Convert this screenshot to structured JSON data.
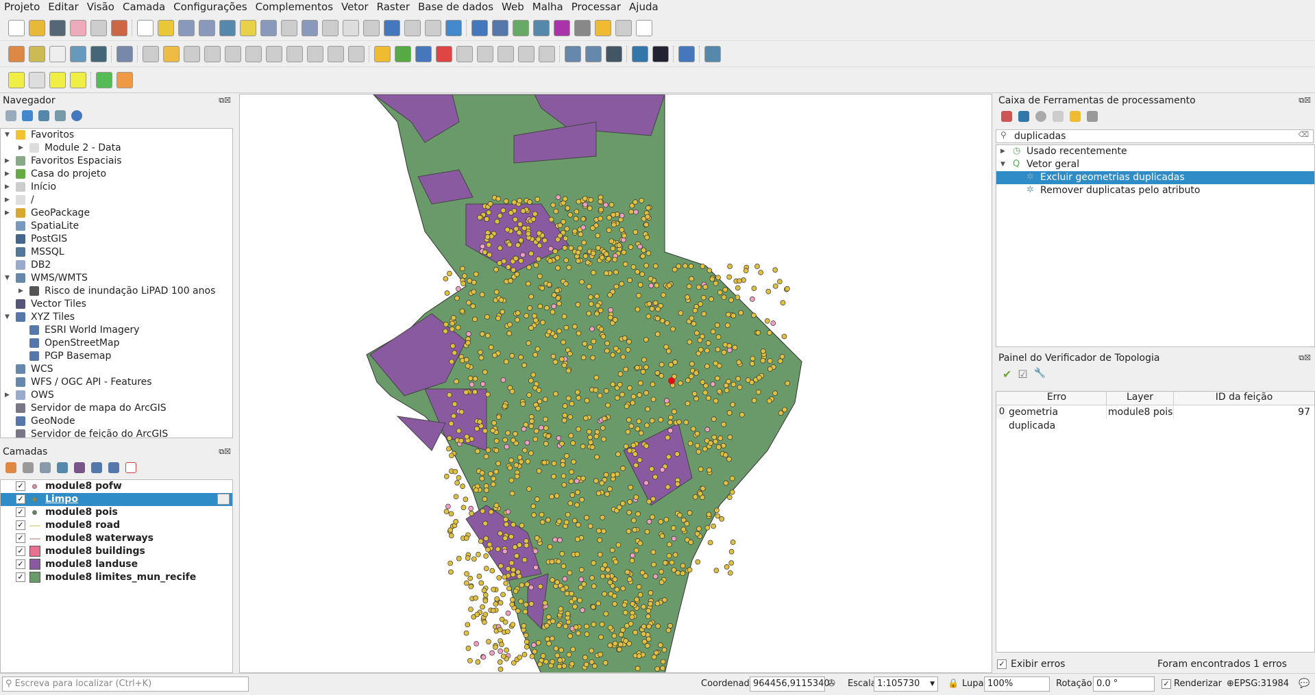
{
  "menu": [
    "Projeto",
    "Editar",
    "Visão",
    "Camada",
    "Configurações",
    "Complementos",
    "Vetor",
    "Raster",
    "Base de dados",
    "Web",
    "Malha",
    "Processar",
    "Ajuda"
  ],
  "navigator": {
    "title": "Navegador",
    "items": [
      {
        "label": "Favoritos",
        "level": 0,
        "expanded": true,
        "icon": "star-icon",
        "color": "#f2c230"
      },
      {
        "label": "Module 2 - Data",
        "level": 1,
        "expanded": false,
        "icon": "folder-icon",
        "color": "#ddd"
      },
      {
        "label": "Favoritos Espaciais",
        "level": 0,
        "expanded": false,
        "icon": "spatial-bookmark-icon",
        "color": "#8a8"
      },
      {
        "label": "Casa do projeto",
        "level": 0,
        "expanded": false,
        "icon": "project-home-icon",
        "color": "#6a4"
      },
      {
        "label": "Início",
        "level": 0,
        "expanded": false,
        "icon": "home-icon",
        "color": "#ccc"
      },
      {
        "label": "/",
        "level": 0,
        "expanded": false,
        "icon": "folder-icon",
        "color": "#ddd"
      },
      {
        "label": "GeoPackage",
        "level": 0,
        "expanded": false,
        "icon": "geopackage-icon",
        "color": "#d9a830"
      },
      {
        "label": "SpatiaLite",
        "level": 0,
        "expanded": null,
        "icon": "spatialite-icon",
        "color": "#7799bb"
      },
      {
        "label": "PostGIS",
        "level": 0,
        "expanded": null,
        "icon": "postgis-icon",
        "color": "#446688"
      },
      {
        "label": "MSSQL",
        "level": 0,
        "expanded": null,
        "icon": "mssql-icon",
        "color": "#557799"
      },
      {
        "label": "DB2",
        "level": 0,
        "expanded": null,
        "icon": "db2-icon",
        "color": "#99aacc"
      },
      {
        "label": "WMS/WMTS",
        "level": 0,
        "expanded": true,
        "icon": "globe-icon",
        "color": "#6688aa"
      },
      {
        "label": "Risco de inundação LiPAD 100 anos",
        "level": 1,
        "expanded": false,
        "icon": "wms-layer-icon",
        "color": "#555"
      },
      {
        "label": "Vector Tiles",
        "level": 0,
        "expanded": null,
        "icon": "vector-tiles-icon",
        "color": "#557"
      },
      {
        "label": "XYZ Tiles",
        "level": 0,
        "expanded": true,
        "icon": "grid-icon",
        "color": "#5577aa"
      },
      {
        "label": "ESRI World Imagery",
        "level": 1,
        "expanded": null,
        "icon": "grid-icon",
        "color": "#5577aa"
      },
      {
        "label": "OpenStreetMap",
        "level": 1,
        "expanded": null,
        "icon": "grid-icon",
        "color": "#5577aa"
      },
      {
        "label": "PGP Basemap",
        "level": 1,
        "expanded": null,
        "icon": "grid-icon",
        "color": "#5577aa"
      },
      {
        "label": "WCS",
        "level": 0,
        "expanded": null,
        "icon": "globe-icon",
        "color": "#6688aa"
      },
      {
        "label": "WFS / OGC API - Features",
        "level": 0,
        "expanded": null,
        "icon": "globe-icon",
        "color": "#6688aa"
      },
      {
        "label": "OWS",
        "level": 0,
        "expanded": false,
        "icon": "globe-icon",
        "color": "#99aacc"
      },
      {
        "label": "Servidor de mapa do ArcGIS",
        "level": 0,
        "expanded": null,
        "icon": "arcgis-icon",
        "color": "#778"
      },
      {
        "label": "GeoNode",
        "level": 0,
        "expanded": null,
        "icon": "geonode-icon",
        "color": "#5577aa"
      },
      {
        "label": "Servidor de feição do ArcGIS",
        "level": 0,
        "expanded": null,
        "icon": "arcgis-icon",
        "color": "#778"
      }
    ]
  },
  "layers": {
    "title": "Camadas",
    "items": [
      {
        "label": "module8 pofw",
        "symbol": "point",
        "color": "#e88aa0",
        "checked": true,
        "selected": false
      },
      {
        "label": "Limpo",
        "symbol": "point",
        "color": "#8a8a40",
        "checked": true,
        "selected": true
      },
      {
        "label": "module8 pois",
        "symbol": "point",
        "color": "#5a8a5a",
        "checked": true,
        "selected": false
      },
      {
        "label": "module8 road",
        "symbol": "line",
        "color": "#e8dca0",
        "checked": true,
        "selected": false
      },
      {
        "label": "module8 waterways",
        "symbol": "line",
        "color": "#d8b8b0",
        "checked": true,
        "selected": false
      },
      {
        "label": "module8 buildings",
        "symbol": "fill",
        "color": "#e87090",
        "checked": true,
        "selected": false
      },
      {
        "label": "module8 landuse",
        "symbol": "fill",
        "color": "#8a5aa0",
        "checked": true,
        "selected": false
      },
      {
        "label": "module8 limites_mun_recife",
        "symbol": "fill",
        "color": "#6a9a6a",
        "checked": true,
        "selected": false
      }
    ]
  },
  "processing": {
    "title": "Caixa de Ferramentas de processamento",
    "search_value": "duplicadas",
    "tree": [
      {
        "label": "Usado recentemente",
        "level": 0,
        "expanded": false,
        "selected": false
      },
      {
        "label": "Vetor geral",
        "level": 0,
        "expanded": true,
        "selected": false
      },
      {
        "label": "Excluir geometrias duplicadas",
        "level": 1,
        "selected": true
      },
      {
        "label": "Remover duplicatas pelo atributo",
        "level": 1,
        "selected": false
      }
    ]
  },
  "topology": {
    "title": "Painel do Verificador de Topologia",
    "columns": [
      "Erro",
      "Layer",
      "ID da feição"
    ],
    "rows": [
      {
        "index": "0",
        "erro": "geometria duplicada",
        "layer": "module8 pois",
        "id": "97"
      }
    ],
    "show_errors_label": "Exibir erros",
    "show_errors_checked": true,
    "status": "Foram encontrados 1 erros"
  },
  "statusbar": {
    "locator_placeholder": "Escreva para localizar (Ctrl+K)",
    "coord_label": "Coordenada",
    "coord_value": "964456,9115340",
    "scale_label": "Escala",
    "scale_value": "1:105730",
    "magnifier_label": "Lupa",
    "magnifier_value": "100%",
    "rotation_label": "Rotação",
    "rotation_value": "0.0 °",
    "render_label": "Renderizar",
    "render_checked": true,
    "crs": "EPSG:31984"
  },
  "colors": {
    "selection": "#308cc6",
    "boundary": "#6a9a6a",
    "landuse": "#8a5aa0",
    "points": "#e0c040"
  }
}
